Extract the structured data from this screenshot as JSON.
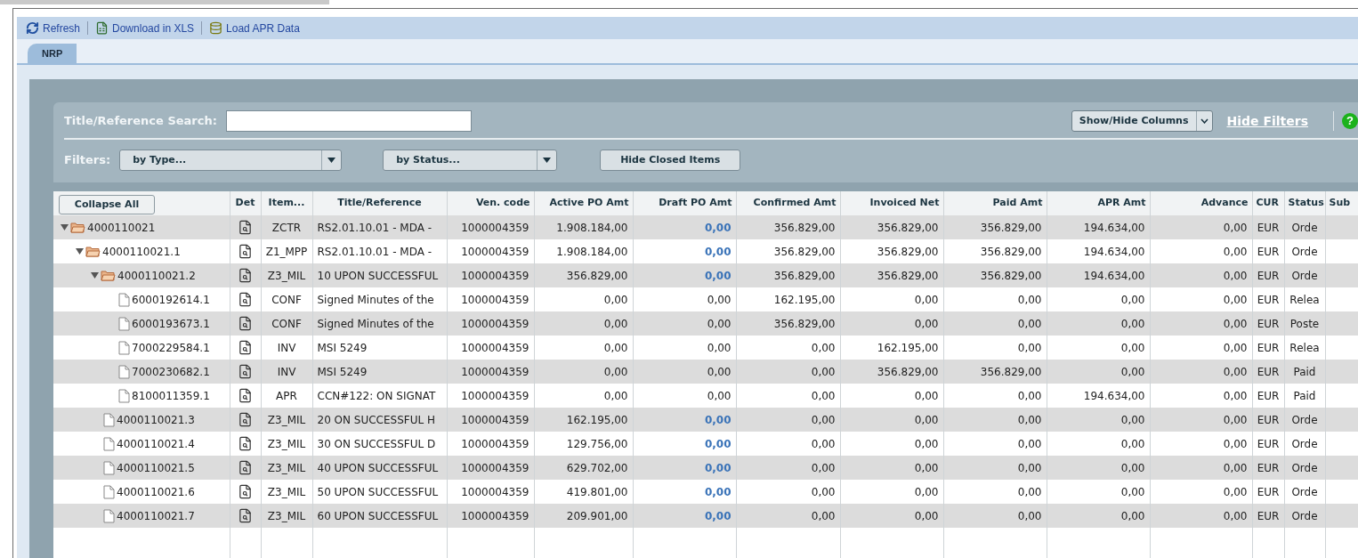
{
  "toolbar": {
    "actions": [
      {
        "label": "Refresh",
        "kind": "refresh"
      },
      {
        "label": "Download in XLS",
        "kind": "xls"
      },
      {
        "label": "Load APR Data",
        "kind": "load"
      }
    ]
  },
  "tabs": [
    {
      "label": "NRP",
      "selected": true
    }
  ],
  "search": {
    "label": "Title/Reference Search:"
  },
  "column_menu": {
    "label": "Show/Hide Columns"
  },
  "hide_filters": "Hide Filters",
  "help": "?",
  "filters": {
    "label": "Filters:",
    "selects": [
      {
        "value": "by Type..."
      },
      {
        "value": "by Status..."
      }
    ],
    "button": "Hide Closed Items"
  },
  "table": {
    "collapse_button": "Collapse All",
    "det_header": "Det",
    "columns": [
      "Item...",
      "Title/Reference",
      "Ven. code",
      "Active PO Amt",
      "Draft PO Amt",
      "Confirmed Amt",
      "Invoiced Net",
      "Paid Amt",
      "APR Amt",
      "Advance",
      "CUR",
      "Status",
      "Sub"
    ],
    "rows": [
      {
        "id": "4000110021",
        "kind": "folder",
        "expanded": true,
        "draft_emphasis": true,
        "cells": [
          "ZCTR",
          "RS2.01.10.01 - MDA -",
          "1000004359",
          "1.908.184,00",
          "0,00",
          "356.829,00",
          "356.829,00",
          "356.829,00",
          "194.634,00",
          "0,00",
          "EUR",
          "Orde"
        ],
        "children": [
          {
            "id": "4000110021.1",
            "kind": "folder",
            "expanded": true,
            "draft_emphasis": true,
            "cells": [
              "Z1_MPP",
              "RS2.01.10.01 - MDA -",
              "1000004359",
              "1.908.184,00",
              "0,00",
              "356.829,00",
              "356.829,00",
              "356.829,00",
              "194.634,00",
              "0,00",
              "EUR",
              "Orde"
            ],
            "children": [
              {
                "id": "4000110021.2",
                "kind": "folder",
                "expanded": true,
                "draft_emphasis": true,
                "cells": [
                  "Z3_MIL",
                  "10 UPON SUCCESSFUL",
                  "1000004359",
                  "356.829,00",
                  "0,00",
                  "356.829,00",
                  "356.829,00",
                  "356.829,00",
                  "194.634,00",
                  "0,00",
                  "EUR",
                  "Orde"
                ],
                "children": [
                  {
                    "id": "6000192614.1",
                    "kind": "document",
                    "draft_emphasis": false,
                    "cells": [
                      "CONF",
                      "Signed Minutes of the",
                      "1000004359",
                      "0,00",
                      "0,00",
                      "162.195,00",
                      "0,00",
                      "0,00",
                      "0,00",
                      "0,00",
                      "EUR",
                      "Relea"
                    ]
                  },
                  {
                    "id": "6000193673.1",
                    "kind": "document",
                    "draft_emphasis": false,
                    "cells": [
                      "CONF",
                      "Signed Minutes of the",
                      "1000004359",
                      "0,00",
                      "0,00",
                      "356.829,00",
                      "0,00",
                      "0,00",
                      "0,00",
                      "0,00",
                      "EUR",
                      "Poste"
                    ]
                  },
                  {
                    "id": "7000229584.1",
                    "kind": "document",
                    "draft_emphasis": false,
                    "cells": [
                      "INV",
                      "MSI 5249",
                      "1000004359",
                      "0,00",
                      "0,00",
                      "0,00",
                      "162.195,00",
                      "0,00",
                      "0,00",
                      "0,00",
                      "EUR",
                      "Relea"
                    ]
                  },
                  {
                    "id": "7000230682.1",
                    "kind": "document",
                    "draft_emphasis": false,
                    "cells": [
                      "INV",
                      "MSI 5249",
                      "1000004359",
                      "0,00",
                      "0,00",
                      "0,00",
                      "356.829,00",
                      "356.829,00",
                      "0,00",
                      "0,00",
                      "EUR",
                      "Paid"
                    ]
                  },
                  {
                    "id": "8100011359.1",
                    "kind": "document",
                    "draft_emphasis": false,
                    "cells": [
                      "APR",
                      "CCN#122: ON SIGNAT",
                      "1000004359",
                      "0,00",
                      "0,00",
                      "0,00",
                      "0,00",
                      "0,00",
                      "194.634,00",
                      "0,00",
                      "EUR",
                      "Paid"
                    ]
                  }
                ]
              },
              {
                "id": "4000110021.3",
                "kind": "document",
                "draft_emphasis": true,
                "cells": [
                  "Z3_MIL",
                  "20 ON SUCCESSFUL H",
                  "1000004359",
                  "162.195,00",
                  "0,00",
                  "0,00",
                  "0,00",
                  "0,00",
                  "0,00",
                  "0,00",
                  "EUR",
                  "Orde"
                ]
              },
              {
                "id": "4000110021.4",
                "kind": "document",
                "draft_emphasis": true,
                "cells": [
                  "Z3_MIL",
                  "30 ON SUCCESSFUL D",
                  "1000004359",
                  "129.756,00",
                  "0,00",
                  "0,00",
                  "0,00",
                  "0,00",
                  "0,00",
                  "0,00",
                  "EUR",
                  "Orde"
                ]
              },
              {
                "id": "4000110021.5",
                "kind": "document",
                "draft_emphasis": true,
                "cells": [
                  "Z3_MIL",
                  "40 UPON SUCCESSFUL",
                  "1000004359",
                  "629.702,00",
                  "0,00",
                  "0,00",
                  "0,00",
                  "0,00",
                  "0,00",
                  "0,00",
                  "EUR",
                  "Orde"
                ]
              },
              {
                "id": "4000110021.6",
                "kind": "document",
                "draft_emphasis": true,
                "cells": [
                  "Z3_MIL",
                  "50 UPON SUCCESSFUL",
                  "1000004359",
                  "419.801,00",
                  "0,00",
                  "0,00",
                  "0,00",
                  "0,00",
                  "0,00",
                  "0,00",
                  "EUR",
                  "Orde"
                ]
              },
              {
                "id": "4000110021.7",
                "kind": "document",
                "draft_emphasis": true,
                "cells": [
                  "Z3_MIL",
                  "60 UPON SUCCESSFUL",
                  "1000004359",
                  "209.901,00",
                  "0,00",
                  "0,00",
                  "0,00",
                  "0,00",
                  "0,00",
                  "0,00",
                  "EUR",
                  "Orde"
                ]
              }
            ]
          }
        ]
      }
    ]
  }
}
